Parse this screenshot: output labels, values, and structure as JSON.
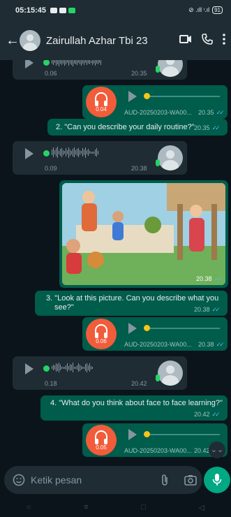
{
  "status_bar": {
    "time": "05:15:45",
    "battery": "91"
  },
  "header": {
    "contact_name": "Zairullah Azhar Tbi 23"
  },
  "messages": [
    {
      "type": "voice-in",
      "duration": "0.06",
      "time": "20.35"
    },
    {
      "type": "audio-out",
      "duration": "0.04",
      "filename": "AUD-20250203-WA00...",
      "time": "20.35"
    },
    {
      "type": "text-out",
      "text": "2. \"Can you describe your daily routine?\"",
      "time": "20.35"
    },
    {
      "type": "voice-in",
      "duration": "0.09",
      "time": "20.38"
    },
    {
      "type": "image-out",
      "time": "20.38"
    },
    {
      "type": "text-out",
      "line1": "3. \"Look at this picture. Can you describe what you",
      "line2": "see?\"",
      "time": "20.38"
    },
    {
      "type": "audio-out",
      "duration": "0.06",
      "filename": "AUD-20250203-WA00...",
      "time": "20.38"
    },
    {
      "type": "voice-in",
      "duration": "0.18",
      "time": "20.42"
    },
    {
      "type": "text-out",
      "text": "4. \"What do you think about face to face learning?\"",
      "time": "20.42"
    },
    {
      "type": "audio-out",
      "duration": "0.05",
      "filename": "AUD-20250203-WA00...",
      "time": "20.42"
    }
  ],
  "input": {
    "placeholder": "Ketik pesan"
  },
  "colors": {
    "outgoing": "#005c4b",
    "incoming": "#1f2c34",
    "accent": "#00a884",
    "audio_icon": "#f15c3a"
  }
}
